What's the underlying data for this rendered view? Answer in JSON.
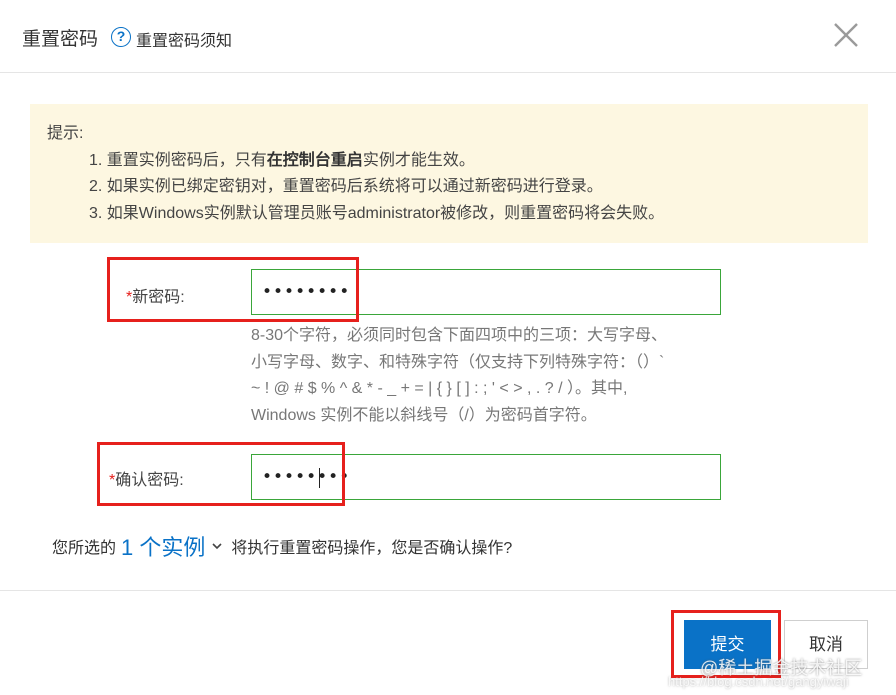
{
  "header": {
    "title": "重置密码",
    "help_icon_glyph": "?",
    "help_link": "重置密码须知",
    "close_icon": "close-icon"
  },
  "notice": {
    "title": "提示:",
    "items": [
      {
        "before": "1. 重置实例密码后，只有",
        "bold": "在控制台重启",
        "after": "实例才能生效。"
      },
      {
        "before": "2. 如果实例已绑定密钥对，重置密码后系统将可以通过新密码进行登录。",
        "bold": "",
        "after": ""
      },
      {
        "before": "3. 如果Windows实例默认管理员账号administrator被修改，则重置密码将会失败。",
        "bold": "",
        "after": ""
      }
    ]
  },
  "form": {
    "new_password": {
      "required_mark": "*",
      "label": "新密码:",
      "value_masked": "••••••••"
    },
    "hint_lines": [
      "8-30个字符，必须同时包含下面四项中的三项：大写字母、",
      "小写字母、数字、和特殊字符（仅支持下列特殊字符：（）`",
      "~ ! @ # $ % ^ & * - _ + = | { } [ ] : ; ' < > , . ? / ）。其中,",
      "Windows 实例不能以斜线号（/）为密码首字符。"
    ],
    "confirm_password": {
      "required_mark": "*",
      "label": "确认密码:",
      "value_masked": "••••••••"
    }
  },
  "confirm": {
    "prefix": "您所选的",
    "instance_link": "1 个实例",
    "suffix": "将执行重置密码操作，您是否确认操作?"
  },
  "buttons": {
    "submit": "提交",
    "cancel": "取消"
  },
  "watermark": {
    "text": "@稀土掘金技术社区",
    "url": "https://blog.csdn.net/gangyiwaji"
  },
  "colors": {
    "primary": "#0a72c7",
    "highlight_red": "#e6201c",
    "valid_green": "#3aa63a",
    "notice_bg": "#fdf7e1"
  }
}
